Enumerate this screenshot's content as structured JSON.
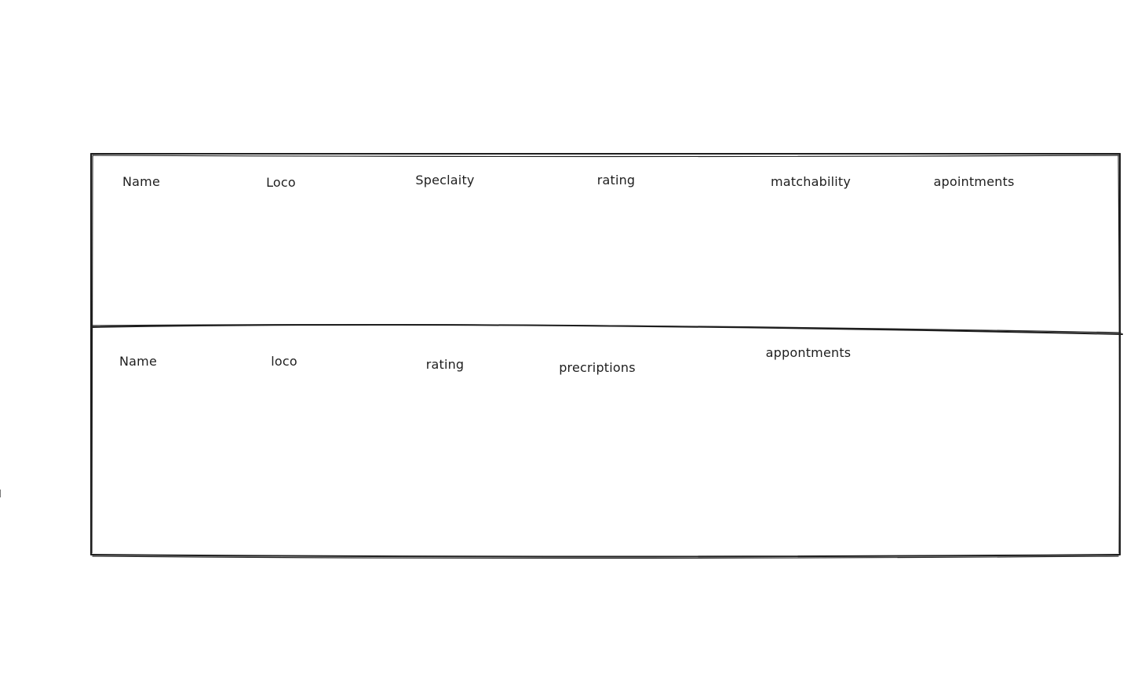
{
  "wireframe": {
    "stroke_color": "#1e1e1e",
    "background_color": "#ffffff",
    "upper_section": {
      "columns": [
        {
          "id": "name",
          "label": "Name"
        },
        {
          "id": "loco",
          "label": "Loco"
        },
        {
          "id": "specialty",
          "label": "Speclaity"
        },
        {
          "id": "rating",
          "label": "rating"
        },
        {
          "id": "matchability",
          "label": "matchability"
        },
        {
          "id": "appointments",
          "label": "apointments"
        }
      ]
    },
    "lower_section": {
      "columns": [
        {
          "id": "name",
          "label": "Name"
        },
        {
          "id": "loco",
          "label": "loco"
        },
        {
          "id": "rating",
          "label": "rating"
        },
        {
          "id": "prescriptions",
          "label": "precriptions"
        },
        {
          "id": "appointments",
          "label": "appontments"
        }
      ]
    }
  }
}
